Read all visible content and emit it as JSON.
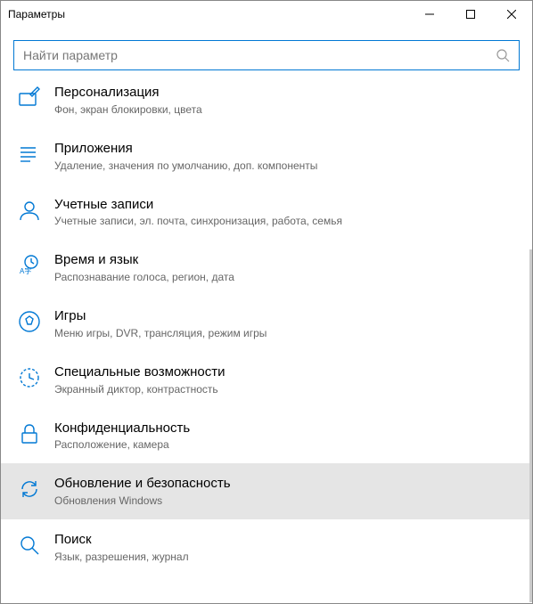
{
  "window": {
    "title": "Параметры"
  },
  "search": {
    "placeholder": "Найти параметр"
  },
  "items": [
    {
      "title": "Персонализация",
      "sub": "Фон, экран блокировки, цвета"
    },
    {
      "title": "Приложения",
      "sub": "Удаление, значения по умолчанию, доп. компоненты"
    },
    {
      "title": "Учетные записи",
      "sub": "Учетные записи, эл. почта, синхронизация, работа, семья"
    },
    {
      "title": "Время и язык",
      "sub": "Распознавание голоса, регион, дата"
    },
    {
      "title": "Игры",
      "sub": "Меню игры, DVR, трансляция, режим игры"
    },
    {
      "title": "Специальные возможности",
      "sub": "Экранный диктор, контрастность"
    },
    {
      "title": "Конфиденциальность",
      "sub": "Расположение, камера"
    },
    {
      "title": "Обновление и безопасность",
      "sub": "Обновления Windows"
    },
    {
      "title": "Поиск",
      "sub": "Язык, разрешения, журнал"
    }
  ]
}
